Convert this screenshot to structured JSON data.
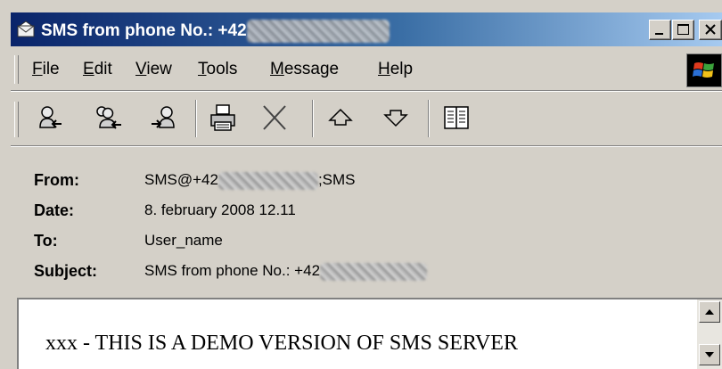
{
  "window": {
    "title": "SMS from phone No.: +42",
    "icon": "envelope-icon"
  },
  "menu": {
    "items": [
      {
        "mnemonic": "F",
        "rest": "ile"
      },
      {
        "mnemonic": "E",
        "rest": "dit"
      },
      {
        "mnemonic": "V",
        "rest": "iew"
      },
      {
        "mnemonic": "T",
        "rest": "ools"
      },
      {
        "mnemonic": "M",
        "rest": "essage"
      },
      {
        "mnemonic": "H",
        "rest": "elp"
      }
    ]
  },
  "toolbar": {
    "icons": [
      "reply-icon",
      "reply-all-icon",
      "forward-icon",
      "print-icon",
      "delete-icon",
      "previous-icon",
      "next-icon",
      "address-book-icon"
    ]
  },
  "message": {
    "from_label": "From:",
    "from_value_prefix": "SMS@+42",
    "from_value_suffix": ";SMS",
    "date_label": "Date:",
    "date_value": "8. february 2008 12.11",
    "to_label": "To:",
    "to_value": "User_name",
    "subject_label": "Subject:",
    "subject_value_prefix": "SMS from phone No.: +42",
    "body": "xxx - THIS IS A DEMO VERSION OF SMS SERVER"
  },
  "colors": {
    "titlebar_start": "#0a246a",
    "titlebar_end": "#a6caf0",
    "face": "#d4d0c8"
  }
}
